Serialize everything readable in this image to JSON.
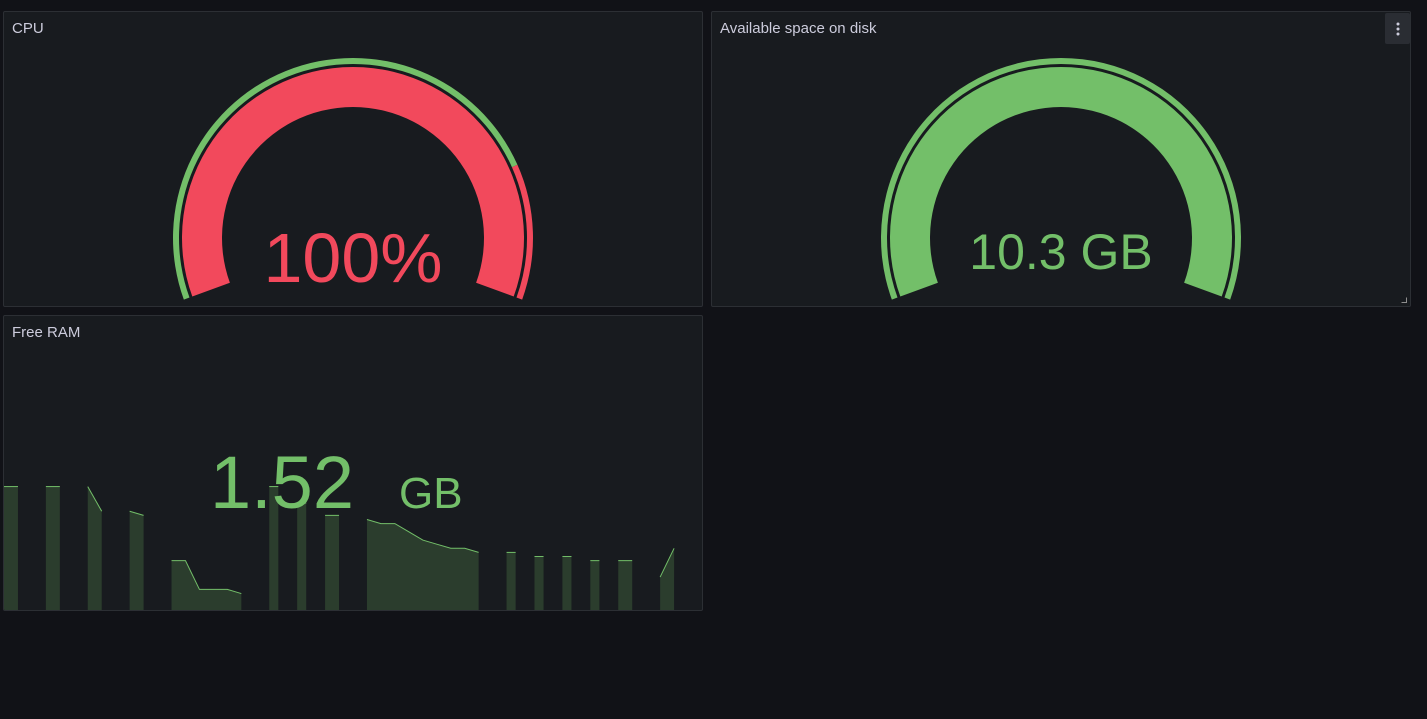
{
  "panels": {
    "cpu": {
      "title": "CPU",
      "gauge": {
        "value": 100,
        "display": "100%",
        "min": 0,
        "max": 100,
        "value_color": "#f2495c",
        "thresholds": [
          {
            "from": 0,
            "to": 80,
            "color": "#73bf69"
          },
          {
            "from": 80,
            "to": 100,
            "color": "#f2495c"
          }
        ]
      }
    },
    "disk": {
      "title": "Available space on disk",
      "menu_icon": "vertical-dots-icon",
      "resize_icon": "resize-corner-icon",
      "gauge": {
        "fill_fraction": 1.0,
        "display": "10.3 GB",
        "value_color": "#73bf69",
        "threshold_color": "#73bf69"
      }
    },
    "ram": {
      "title": "Free RAM",
      "stat": {
        "value": "1.52",
        "unit": "GB",
        "color": "#73bf69"
      }
    }
  },
  "colors": {
    "background": "#111217",
    "panel": "#181b1f",
    "panel_border": "#2c2f34",
    "title": "#ccccdc",
    "green": "#73bf69",
    "red": "#f2495c",
    "sparkline_fill": "#2b3d2d"
  },
  "chart_data": {
    "type": "area",
    "series": [
      {
        "segments": [
          [
            1.55,
            1.55
          ],
          [
            1.55,
            1.55
          ],
          [
            1.55,
            1.49
          ],
          [
            1.49,
            1.48
          ],
          [
            1.37,
            1.37,
            1.3,
            1.3,
            1.3,
            1.29
          ],
          [
            1.55
          ],
          [
            1.51
          ],
          [
            1.48,
            1.48
          ],
          [
            1.47,
            1.46,
            1.46,
            1.44,
            1.42,
            1.41,
            1.4,
            1.4,
            1.39
          ],
          [
            1.39
          ],
          [
            1.38
          ],
          [
            1.38
          ],
          [
            1.37
          ],
          [
            1.37,
            1.37
          ],
          [
            1.33,
            1.4
          ]
        ]
      }
    ],
    "ylim": [
      1.25,
      1.6
    ]
  }
}
